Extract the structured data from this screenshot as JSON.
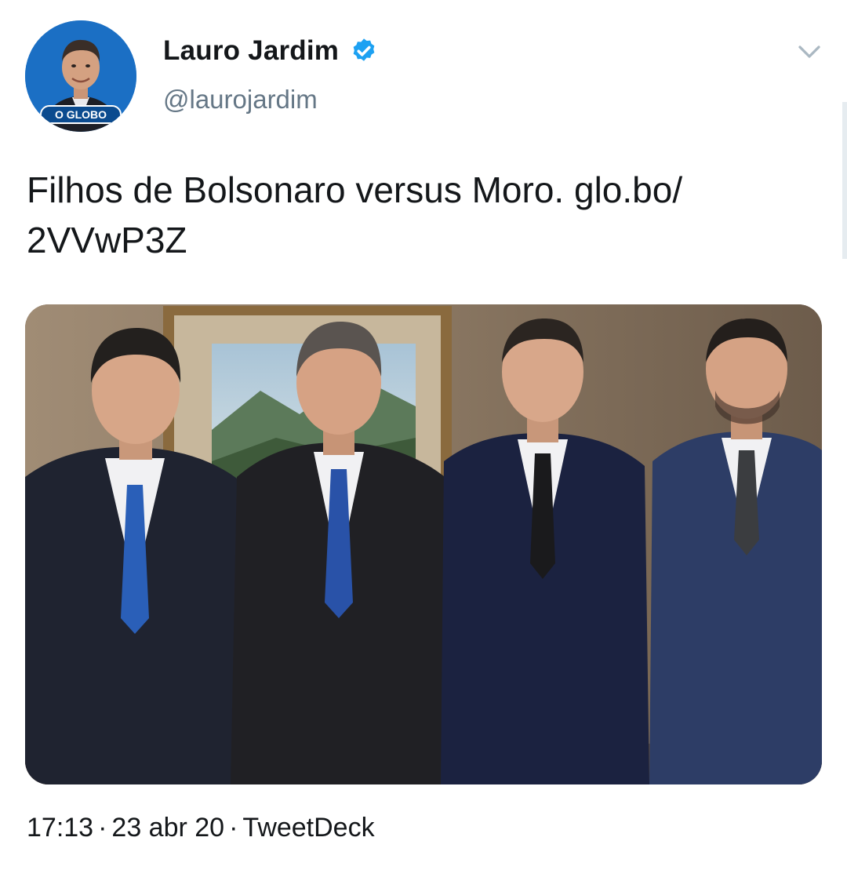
{
  "tweet": {
    "author": {
      "display_name": "Lauro Jardim",
      "handle": "@laurojardim",
      "verified": true,
      "avatar_badge": "O GLOBO"
    },
    "text_main": "Filhos de Bolsonaro versus Moro. ",
    "text_link": "glo.bo/ 2VVwP3Z",
    "media_alt": "photo",
    "time": "17:13",
    "date": "23 abr 20",
    "source": "TweetDeck",
    "separator": "·"
  },
  "icons": {
    "verified": "verified-badge-icon",
    "menu": "chevron-down-icon"
  },
  "colors": {
    "verified_blue": "#1da1f2",
    "text": "#14171a",
    "secondary": "#657786"
  }
}
